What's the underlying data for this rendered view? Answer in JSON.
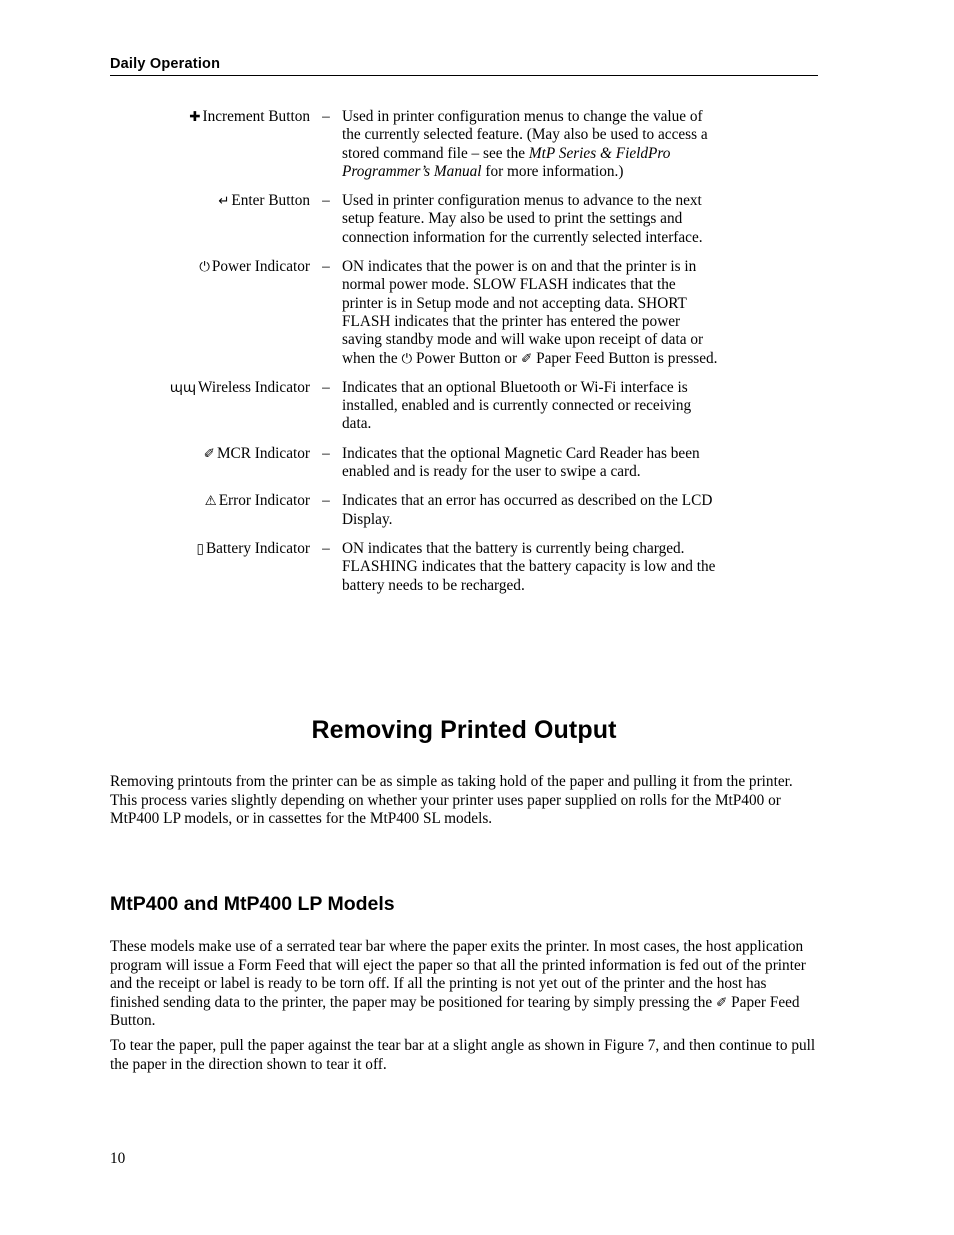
{
  "header": {
    "running_head": "Daily Operation"
  },
  "definitions": [
    {
      "icon": "plus-icon",
      "glyph": "✚",
      "term": "Increment Button",
      "dash": "–",
      "desc_parts": [
        {
          "type": "text",
          "text": "Used in printer configuration menus to change the value of the currently selected feature.  (May also be used to access a stored command file – see the "
        },
        {
          "type": "italic",
          "text": "MtP Series & FieldPro Programmer’s Manual"
        },
        {
          "type": "text",
          "text": " for more information.)"
        }
      ]
    },
    {
      "icon": "enter-arrow-icon",
      "glyph": "↵",
      "term": "Enter Button",
      "dash": "–",
      "desc_parts": [
        {
          "type": "text",
          "text": "Used in printer configuration menus to advance to the next setup feature.  May also be used to print the settings and connection information for the currently selected interface."
        }
      ]
    },
    {
      "icon": "power-icon",
      "glyph": "⏻",
      "term": "Power Indicator",
      "dash": "–",
      "desc_parts": [
        {
          "type": "text",
          "text": "ON indicates that the power is on and that the printer is in normal power mode.  SLOW FLASH indicates that the printer is in Setup mode and not accepting data.  SHORT FLASH indicates that the printer has entered the power saving standby mode and will wake upon receipt of data or when the "
        },
        {
          "type": "glyph",
          "text": "⏻",
          "icon": "power-icon"
        },
        {
          "type": "text",
          "text": " Power Button or "
        },
        {
          "type": "glyph",
          "text": "✐",
          "icon": "paper-feed-icon"
        },
        {
          "type": "text",
          "text": " Paper Feed Button is pressed."
        }
      ]
    },
    {
      "icon": "wireless-icon",
      "glyph": "ɰɰ",
      "term": "Wireless Indicator",
      "dash": "–",
      "desc_parts": [
        {
          "type": "text",
          "text": "Indicates that an optional Bluetooth or Wi-Fi interface is installed, enabled and is currently connected or receiving data."
        }
      ]
    },
    {
      "icon": "mcr-card-icon",
      "glyph": "✐",
      "term": "MCR Indicator",
      "dash": "–",
      "desc_parts": [
        {
          "type": "text",
          "text": "Indicates that the optional Magnetic Card Reader has been enabled and is ready for the user to swipe a card."
        }
      ]
    },
    {
      "icon": "warning-triangle-icon",
      "glyph": "⚠",
      "term": "Error Indicator",
      "dash": "–",
      "desc_parts": [
        {
          "type": "text",
          "text": "Indicates that an error has occurred as described on the LCD Display."
        }
      ]
    },
    {
      "icon": "battery-icon",
      "glyph": "▯",
      "term": "Battery Indicator",
      "dash": "–",
      "desc_parts": [
        {
          "type": "text",
          "text": "ON indicates that the battery is currently being charged.  FLASHING indicates that the battery capacity is low and the battery needs to be recharged."
        }
      ]
    }
  ],
  "section": {
    "title": "Removing Printed Output",
    "intro": "Removing printouts from the printer can be as simple as taking hold of the paper and pulling it from the printer.  This process varies slightly depending on whether your printer uses paper supplied on rolls for the MtP400 or MtP400 LP models, or in cassettes for the MtP400 SL models.",
    "subheading": "MtP400 and MtP400 LP Models",
    "models_parts": [
      {
        "type": "text",
        "text": "These models make use of a serrated tear bar where the paper exits the printer.  In most cases, the host application program will issue a Form Feed that will eject the paper so that all the printed information is fed out of the printer and the receipt or label is ready to be torn off.  If all the printing is not yet out of the printer and the host has finished sending data to the printer, the paper may be positioned for tearing by simply pressing the "
      },
      {
        "type": "glyph",
        "text": "✐",
        "icon": "paper-feed-icon"
      },
      {
        "type": "text",
        "text": " Paper Feed Button."
      }
    ],
    "tear": "To tear the paper, pull the paper against the tear bar at a slight angle as shown in Figure 7, and then continue to pull the paper in the direction shown to tear it off."
  },
  "footer": {
    "page_number": "10"
  }
}
